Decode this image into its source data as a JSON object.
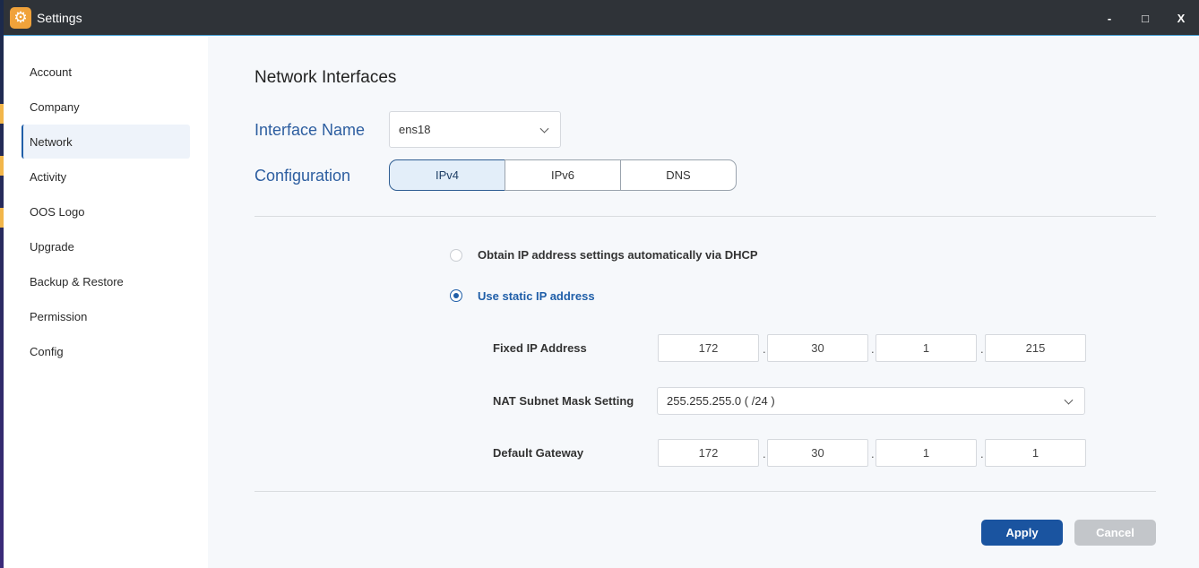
{
  "window": {
    "title": "Settings",
    "minimize": "-",
    "maximize": "□",
    "close": "X"
  },
  "sidebar": {
    "items": [
      {
        "label": "Account"
      },
      {
        "label": "Company"
      },
      {
        "label": "Network",
        "active": true
      },
      {
        "label": "Activity"
      },
      {
        "label": "OOS Logo"
      },
      {
        "label": "Upgrade"
      },
      {
        "label": "Backup & Restore"
      },
      {
        "label": "Permission"
      },
      {
        "label": "Config"
      }
    ]
  },
  "main": {
    "title": "Network Interfaces",
    "interface_label": "Interface Name",
    "interface_value": "ens18",
    "config_label": "Configuration",
    "tabs": [
      {
        "label": "IPv4",
        "active": true
      },
      {
        "label": "IPv6"
      },
      {
        "label": "DNS"
      }
    ],
    "dhcp_option": "Obtain IP address settings automatically via DHCP",
    "static_option": "Use static IP address",
    "selected_option": "static",
    "fixed_ip_label": "Fixed IP Address",
    "fixed_ip": [
      "172",
      "30",
      "1",
      "215"
    ],
    "subnet_label": "NAT Subnet Mask Setting",
    "subnet_value": "255.255.255.0 ( /24 )",
    "gateway_label": "Default Gateway",
    "gateway": [
      "172",
      "30",
      "1",
      "1"
    ],
    "separator": ".",
    "apply_label": "Apply",
    "cancel_label": "Cancel"
  },
  "colors": {
    "accent": "#1a54a0",
    "label_blue": "#2d5ea0",
    "titlebar": "#2f3338",
    "app_icon": "#f0a23a"
  }
}
